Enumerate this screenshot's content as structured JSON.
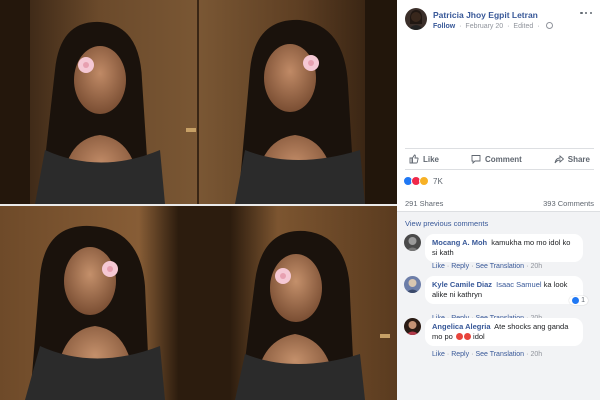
{
  "post": {
    "author": "Patricia Jhoy Egpit Letran",
    "follow_label": "Follow",
    "date": "February 20",
    "edited_label": "Edited",
    "more_icon": "ellipsis-icon",
    "privacy_icon": "globe-icon"
  },
  "actions": {
    "like": "Like",
    "comment": "Comment",
    "share": "Share"
  },
  "reactions": {
    "types": [
      "like",
      "love",
      "wow"
    ],
    "count": "7K"
  },
  "stats": {
    "shares": "291 Shares",
    "comments": "393 Comments"
  },
  "comments_section": {
    "view_previous": "View previous comments",
    "items": [
      {
        "name": "Mocang A. Moh",
        "text": "kamukha mo mo idol ko si kath",
        "like": "Like",
        "reply": "Reply",
        "see_translation": "See Translation",
        "time": "20h"
      },
      {
        "name": "Kyle Camile Diaz",
        "tag": "Isaac Samuel",
        "text": "ka look alike ni kathryn",
        "like": "Like",
        "reply": "Reply",
        "see_translation": "See Translation",
        "time": "20h",
        "reaction_count": "1"
      },
      {
        "name": "Angelica Alegria",
        "text": "Ate shocks ang ganda mo po",
        "text_after": "idol",
        "like": "Like",
        "reply": "Reply",
        "see_translation": "See Translation",
        "time": "20h"
      }
    ]
  },
  "colors": {
    "link": "#385898",
    "like_blue": "#2078f4",
    "love_red": "#f0284a",
    "wow_yellow": "#f7b125",
    "comment_bg": "#f2f3f5"
  }
}
